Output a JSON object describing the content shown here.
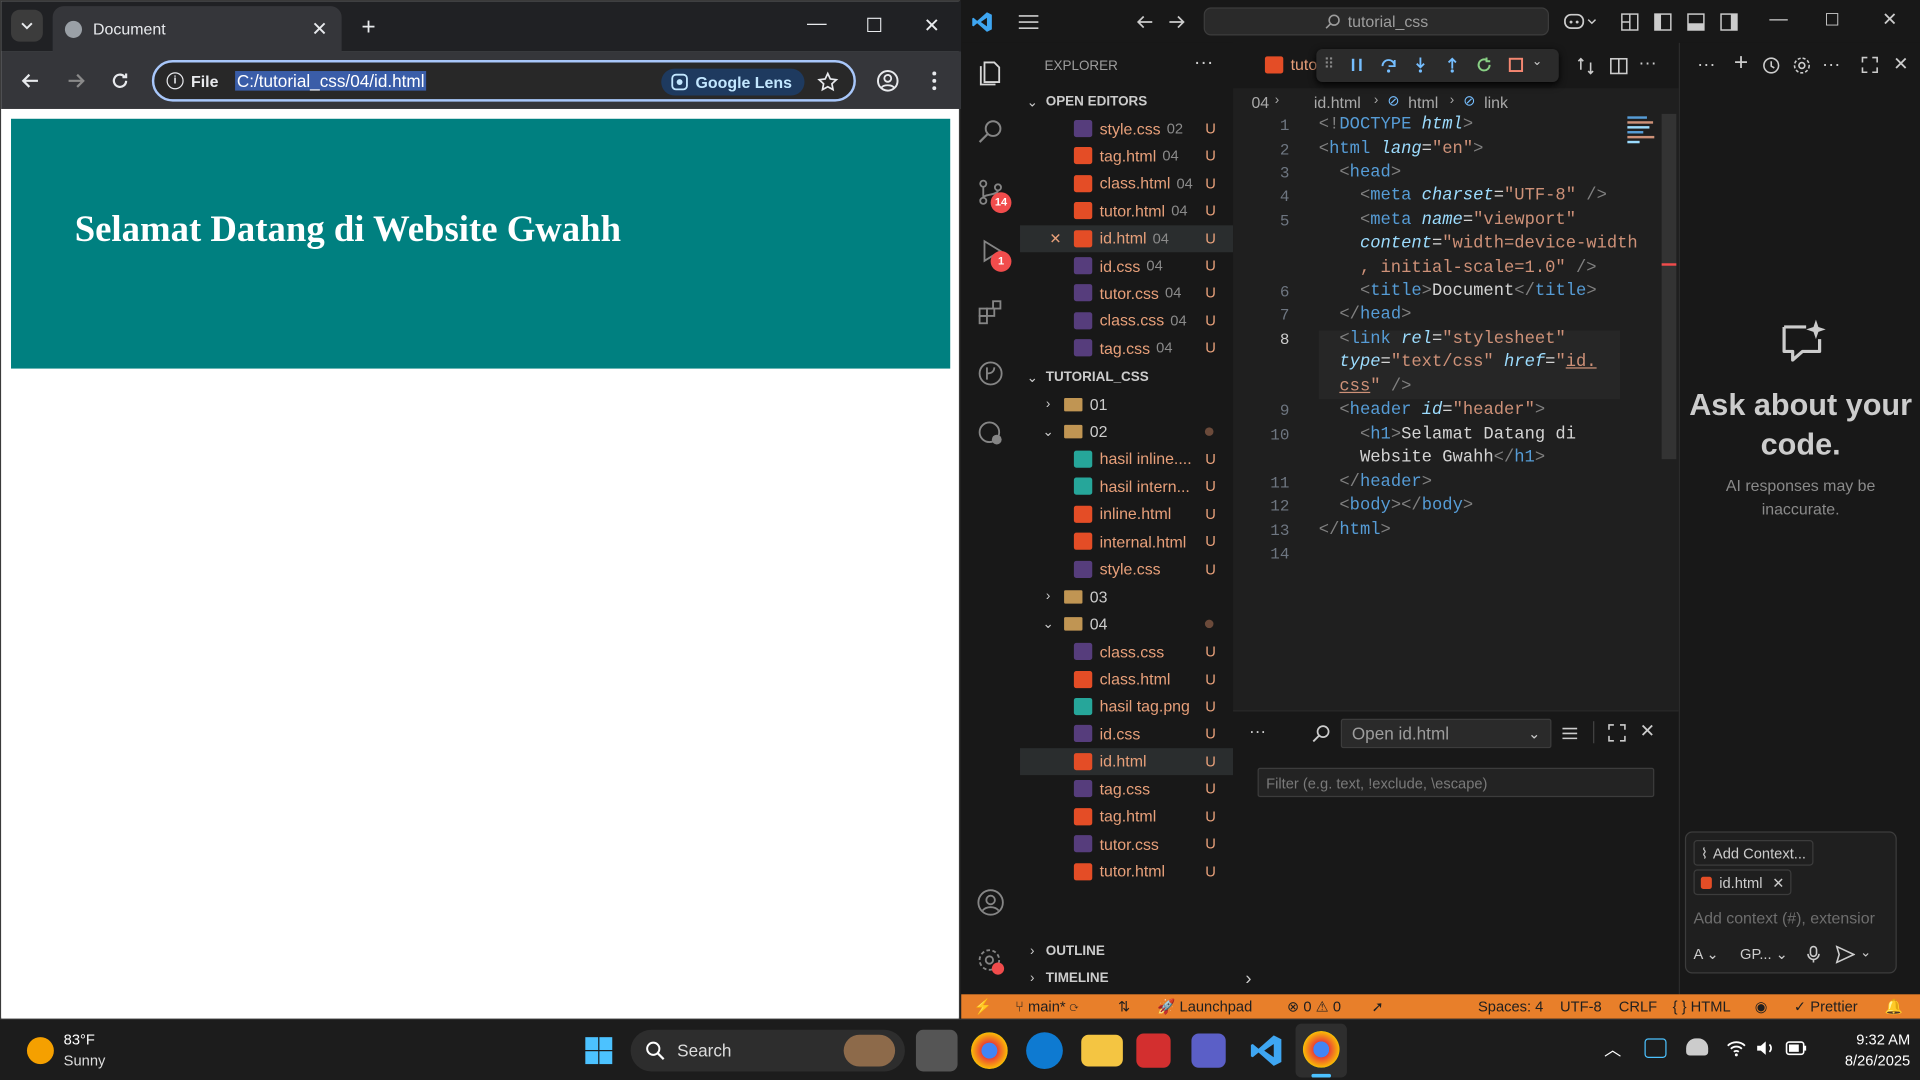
{
  "chrome": {
    "tab_title": "Document",
    "omnibox_scheme": "File",
    "url": "C:/tutorial_css/04/id.html",
    "lens_label": "Google Lens",
    "page_heading": "Selamat Datang di Website Gwahh",
    "header_color": "#008080"
  },
  "vscode": {
    "command_center": "tutorial_css",
    "explorer_title": "EXPLORER",
    "open_editors_label": "OPEN EDITORS",
    "open_editors": [
      {
        "name": "style.css",
        "dir": "02",
        "type": "css",
        "status": "U"
      },
      {
        "name": "tag.html",
        "dir": "04",
        "type": "html",
        "status": "U"
      },
      {
        "name": "class.html",
        "dir": "04",
        "type": "html",
        "status": "U"
      },
      {
        "name": "tutor.html",
        "dir": "04",
        "type": "html",
        "status": "U"
      },
      {
        "name": "id.html",
        "dir": "04",
        "type": "html",
        "status": "U",
        "active": true
      },
      {
        "name": "id.css",
        "dir": "04",
        "type": "css",
        "status": "U"
      },
      {
        "name": "tutor.css",
        "dir": "04",
        "type": "css",
        "status": "U"
      },
      {
        "name": "class.css",
        "dir": "04",
        "type": "css",
        "status": "U"
      },
      {
        "name": "tag.css",
        "dir": "04",
        "type": "css",
        "status": "U"
      }
    ],
    "workspace_label": "TUTORIAL_CSS",
    "tree": [
      {
        "name": "01",
        "type": "folder",
        "depth": 0
      },
      {
        "name": "02",
        "type": "folder",
        "depth": 0,
        "open": true
      },
      {
        "name": "hasil inline....",
        "type": "img",
        "depth": 1,
        "status": "U"
      },
      {
        "name": "hasil intern...",
        "type": "img",
        "depth": 1,
        "status": "U"
      },
      {
        "name": "inline.html",
        "type": "html",
        "depth": 1,
        "status": "U"
      },
      {
        "name": "internal.html",
        "type": "html",
        "depth": 1,
        "status": "U"
      },
      {
        "name": "style.css",
        "type": "css",
        "depth": 1,
        "status": "U"
      },
      {
        "name": "03",
        "type": "folder",
        "depth": 0
      },
      {
        "name": "04",
        "type": "folder",
        "depth": 0,
        "open": true
      },
      {
        "name": "class.css",
        "type": "css",
        "depth": 1,
        "status": "U"
      },
      {
        "name": "class.html",
        "type": "html",
        "depth": 1,
        "status": "U"
      },
      {
        "name": "hasil tag.png",
        "type": "img",
        "depth": 1,
        "status": "U"
      },
      {
        "name": "id.css",
        "type": "css",
        "depth": 1,
        "status": "U"
      },
      {
        "name": "id.html",
        "type": "html",
        "depth": 1,
        "status": "U",
        "active": true
      },
      {
        "name": "tag.css",
        "type": "css",
        "depth": 1,
        "status": "U"
      },
      {
        "name": "tag.html",
        "type": "html",
        "depth": 1,
        "status": "U"
      },
      {
        "name": "tutor.css",
        "type": "css",
        "depth": 1,
        "status": "U"
      },
      {
        "name": "tutor.html",
        "type": "html",
        "depth": 1,
        "status": "U"
      }
    ],
    "outline_label": "OUTLINE",
    "timeline_label": "TIMELINE",
    "editor_tab_label": "tuto",
    "breadcrumb": [
      "04",
      "id.html",
      "html",
      "link"
    ],
    "line_numbers": [
      "1",
      "2",
      "3",
      "4",
      "5",
      "6",
      "7",
      "8",
      "9",
      "10",
      "11",
      "12",
      "13",
      "14"
    ],
    "panel_open_label": "Open id.html",
    "panel_filter_placeholder": "Filter (e.g. text, !exclude, \\escape)",
    "chat_title": "Ask about your code.",
    "chat_subtitle": "AI responses may be inaccurate.",
    "chat_add_context": "Add Context...",
    "chat_context_file": "id.html",
    "chat_input_placeholder": "Add context (#), extensior",
    "chat_mode": "A",
    "chat_model": "GP...",
    "badges": {
      "source_control": "14",
      "run_debug": "1"
    },
    "status_bar": {
      "branch": "main*",
      "launchpad": "Launchpad",
      "errors": "0",
      "warnings": "0",
      "spaces": "Spaces: 4",
      "encoding": "UTF-8",
      "eol": "CRLF",
      "language": "HTML",
      "formatter": "Prettier"
    },
    "status_color": "#e87f2a"
  },
  "taskbar": {
    "weather_temp": "83°F",
    "weather_desc": "Sunny",
    "search_label": "Search",
    "time": "9:32 AM",
    "date": "8/26/2025"
  }
}
